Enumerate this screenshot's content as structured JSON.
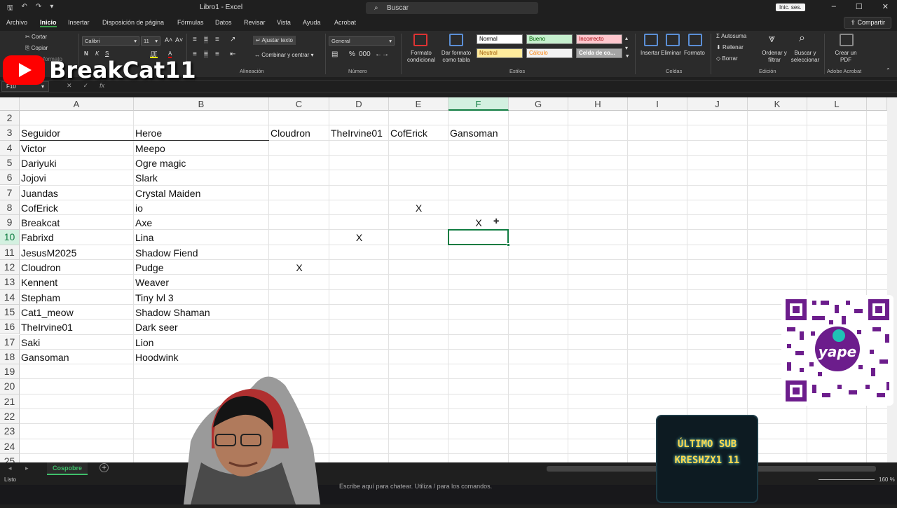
{
  "titlebar": {
    "title": "Libro1 - Excel",
    "search_placeholder": "Buscar",
    "signin": "Inic. ses."
  },
  "menu": {
    "tabs": [
      "Archivo",
      "Inicio",
      "Insertar",
      "Disposición de página",
      "Fórmulas",
      "Datos",
      "Revisar",
      "Vista",
      "Ayuda",
      "Acrobat"
    ],
    "active": "Inicio",
    "share": "Compartir"
  },
  "ribbon": {
    "cut": "Cortar",
    "copy": "Copiar",
    "paste_format": "Copiar formato",
    "font_name": "Calibri",
    "font_size": "11",
    "wrap_text": "Ajustar texto",
    "merge_center": "Combinar y centrar",
    "number_format": "General",
    "cond_format": "Formato condicional",
    "table_format": "Dar formato como tabla",
    "styles": {
      "normal": "Normal",
      "good": "Bueno",
      "bad": "Incorrecto",
      "neutral": "Neutral",
      "calc": "Cálculo",
      "check": "Celda de co..."
    },
    "insert": "Insertar",
    "delete": "Eliminar",
    "format": "Formato",
    "autosum": "Autosuma",
    "fill": "Rellenar",
    "clear": "Borrar",
    "sort_filter": "Ordenar y filtrar",
    "find_select": "Buscar y seleccionar",
    "create_pdf": "Crear un PDF",
    "groups": {
      "alignment": "Alineación",
      "number": "Número",
      "styles": "Estilos",
      "cells": "Celdas",
      "editing": "Edición",
      "acrobat": "Adobe Acrobat"
    }
  },
  "formula_bar": {
    "name_box": "F10",
    "fx": "fx"
  },
  "sheet": {
    "columns": [
      "A",
      "B",
      "C",
      "D",
      "E",
      "F",
      "G",
      "H",
      "I",
      "J",
      "K",
      "L"
    ],
    "selected_column": "F",
    "row_numbers": [
      "2",
      "3",
      "4",
      "5",
      "6",
      "7",
      "8",
      "9",
      "10",
      "11",
      "12",
      "13",
      "14",
      "15",
      "16",
      "17",
      "18",
      "19",
      "20",
      "21",
      "22",
      "23",
      "24",
      "25"
    ],
    "header_row": {
      "a": "Seguidor",
      "b": "Heroe",
      "c": "Cloudron",
      "d": "TheIrvine01",
      "e": "CofErick",
      "f": "Gansoman"
    },
    "rows": [
      {
        "a": " Victor",
        "b": "Meepo",
        "c": "",
        "d": "",
        "e": "",
        "f": ""
      },
      {
        "a": "Dariyuki",
        "b": "Ogre magic",
        "c": "",
        "d": "",
        "e": "",
        "f": ""
      },
      {
        "a": "Jojovi",
        "b": "Slark",
        "c": "",
        "d": "",
        "e": "",
        "f": ""
      },
      {
        "a": "Juandas",
        "b": "Crystal Maiden",
        "c": "",
        "d": "",
        "e": "",
        "f": ""
      },
      {
        "a": "CofErick",
        "b": "io",
        "c": "",
        "d": "",
        "e": "X",
        "f": ""
      },
      {
        "a": "Breakcat",
        "b": "Axe",
        "c": "",
        "d": "",
        "e": "",
        "f": "X"
      },
      {
        "a": "Fabrixd",
        "b": "Lina",
        "c": "",
        "d": "X",
        "e": "",
        "f": ""
      },
      {
        "a": "JesusM2025",
        "b": "Shadow Fiend",
        "c": "",
        "d": "",
        "e": "",
        "f": ""
      },
      {
        "a": "Cloudron",
        "b": "Pudge",
        "c": "X",
        "d": "",
        "e": "",
        "f": ""
      },
      {
        "a": "Kennent",
        "b": "Weaver",
        "c": "",
        "d": "",
        "e": "",
        "f": ""
      },
      {
        "a": " Stepham",
        "b": "Tiny lvl 3",
        "c": "",
        "d": "",
        "e": "",
        "f": ""
      },
      {
        "a": "Cat1_meow",
        "b": "Shadow Shaman",
        "c": "",
        "d": "",
        "e": "",
        "f": ""
      },
      {
        "a": " TheIrvine01",
        "b": "Dark seer",
        "c": "",
        "d": "",
        "e": "",
        "f": ""
      },
      {
        "a": "Saki",
        "b": "Lion",
        "c": "",
        "d": "",
        "e": "",
        "f": ""
      },
      {
        "a": "Gansoman",
        "b": "Hoodwink",
        "c": "",
        "d": "",
        "e": "",
        "f": ""
      }
    ],
    "active_cell": "F10"
  },
  "sheet_tabs": {
    "active": "Cospobre",
    "add": "+"
  },
  "status": {
    "ready": "Listo",
    "zoom": "160 %"
  },
  "chat": {
    "placeholder": "Escribe aquí para chatear. Utiliza / para los comandos."
  },
  "overlay": {
    "brand": "BreakCat11",
    "last_sub_title": "ÚLTIMO SUB",
    "last_sub_name": "KRESHZX1 11",
    "qr_label": "yape"
  },
  "colors": {
    "excel_green": "#107c41",
    "youtube_red": "#ff0000",
    "yape_purple": "#6c1d8c",
    "sub_yellow": "#ffd84d"
  }
}
